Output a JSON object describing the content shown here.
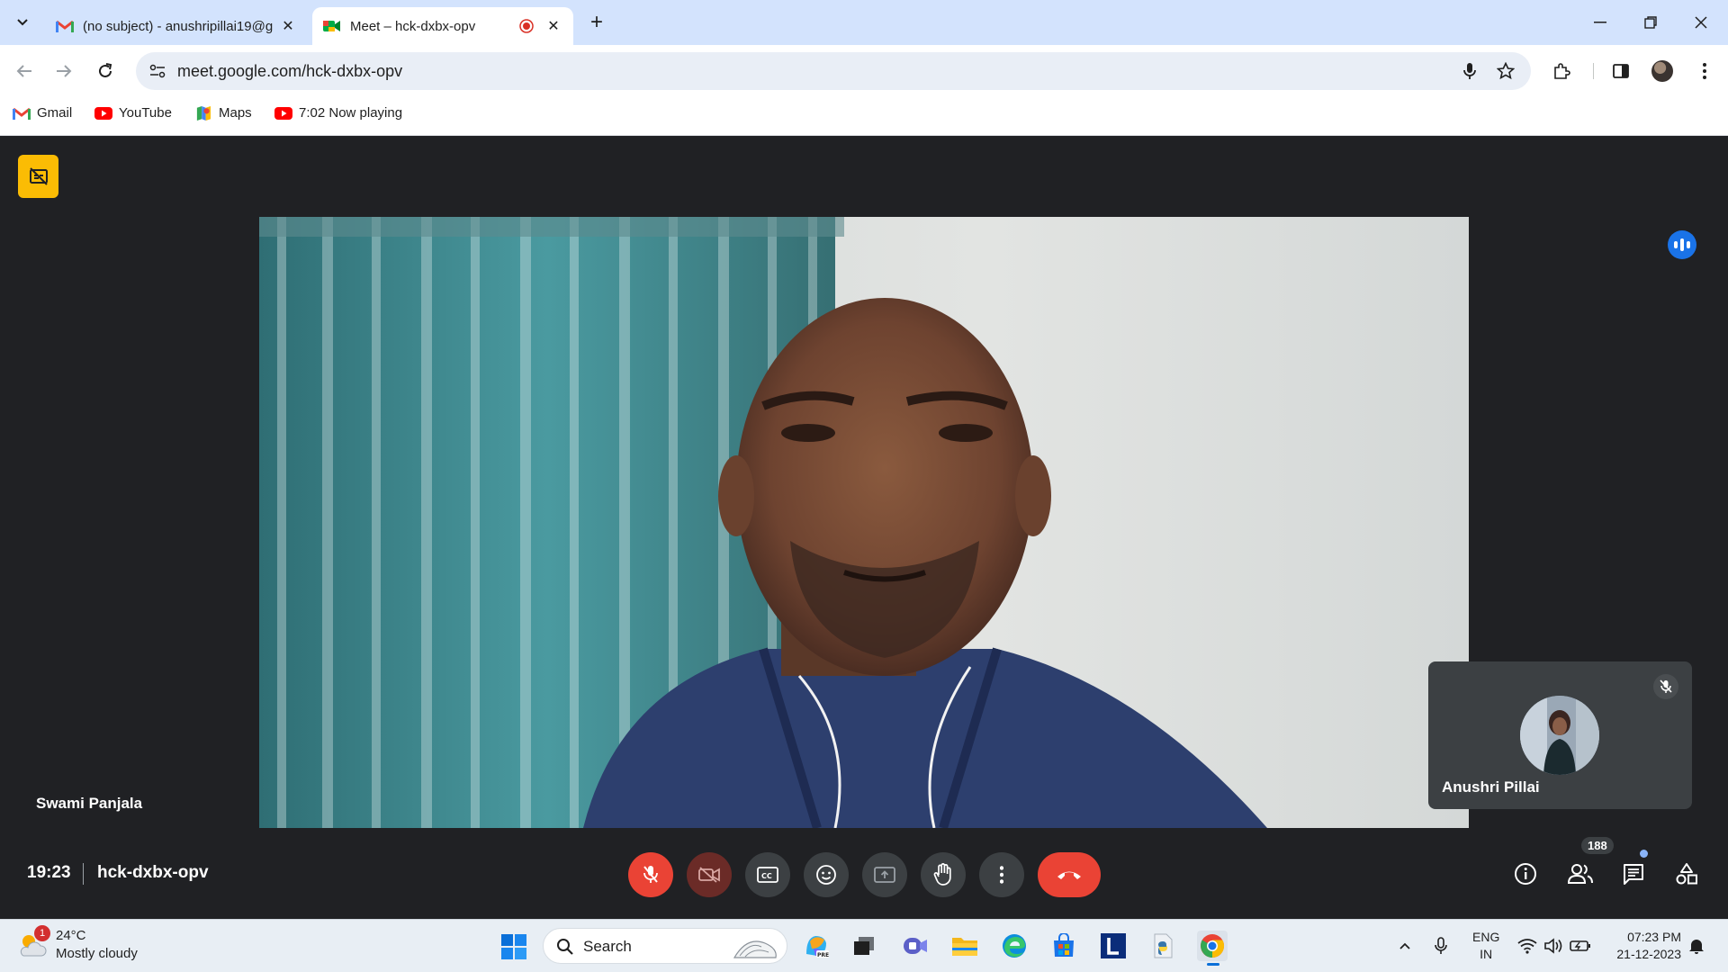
{
  "browser": {
    "tabs": [
      {
        "title": "(no subject) - anushripillai19@g",
        "active": false
      },
      {
        "title": "Meet – hck-dxbx-opv",
        "active": true
      }
    ],
    "url": "meet.google.com/hck-dxbx-opv",
    "bookmarks": [
      {
        "label": "Gmail",
        "icon": "gmail-icon"
      },
      {
        "label": "YouTube",
        "icon": "youtube-icon"
      },
      {
        "label": "Maps",
        "icon": "maps-icon"
      },
      {
        "label": "7:02 Now playing",
        "icon": "youtube-icon"
      }
    ]
  },
  "meet": {
    "speaker_name": "Swami Panjala",
    "self_name": "Anushri Pillai",
    "time": "19:23",
    "meeting_code": "hck-dxbx-opv",
    "people_count": "188",
    "colors": {
      "accent_blue": "#1a73e8",
      "red": "#ea4335",
      "yellow": "#fbbc04",
      "bg": "#202124"
    }
  },
  "taskbar": {
    "weather_temp": "24°C",
    "weather_desc": "Mostly cloudy",
    "weather_badge": "1",
    "search_label": "Search",
    "lang_line1": "ENG",
    "lang_line2": "IN",
    "clock_time": "07:23 PM",
    "clock_date": "21-12-2023"
  }
}
